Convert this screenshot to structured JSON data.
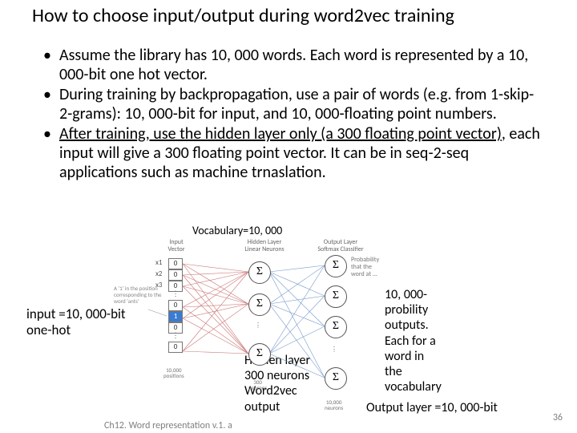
{
  "title": "How to choose input/output during word2vec  training",
  "bullets": [
    "Assume the library has 10, 000 words. Each word is represented by a 10, 000-bit one hot vector.",
    "During training by backpropagation, use a pair of words (e.g. from 1-skip-2-grams): 10, 000-bit for input, and 10, 000-floating point numbers."
  ],
  "bullet3_underlined": "After training, use the hidden layer only (a 300 floating point vector)",
  "bullet3_rest": ", each input will give a 300 floating point vector. It can be in seq-2-seq applications such as machine trnaslation.",
  "vocab_label": "Vocabulary=10, 000",
  "input_label_l1": "input =10, 000-bit",
  "input_label_l2": "one-hot",
  "hidden_label_l1": "Hidden layer",
  "hidden_label_l2": "300 neurons",
  "hidden_label_l3": "Word2vec",
  "hidden_label_l4": "output",
  "out_label_l1": "10, 000-",
  "out_label_l2": "probility",
  "out_label_l3": "outputs.",
  "out_label_l4": "Each for a",
  "out_label_l5": "word in",
  "out_label_l6": "the",
  "out_label_l7": "vocabulary",
  "out_big": "Output layer =10, 000-bit",
  "page_num": "36",
  "footer": "Ch12. Word  representation v.1.  a",
  "tiny_iv": "Input Vector",
  "tiny_hl_l1": "Hidden Layer",
  "tiny_hl_l2": "Linear Neurons",
  "tiny_ol_l1": "Output Layer",
  "tiny_ol_l2": "Softmax Classifier",
  "onehot_values": [
    "0",
    "0",
    "0",
    "0",
    "1",
    "0",
    "0"
  ],
  "x_labels": [
    "x1",
    "x2",
    "x3"
  ],
  "sigma": "Σ",
  "ten_k_l1": "10,000",
  "ten_k_l2": "positions",
  "three_h_l1": "300",
  "three_h_l2": "neurons",
  "left_caption_l1": "A '1' in the position",
  "left_caption_l2": "corresponding to the",
  "left_caption_l3": "word 'ants'"
}
